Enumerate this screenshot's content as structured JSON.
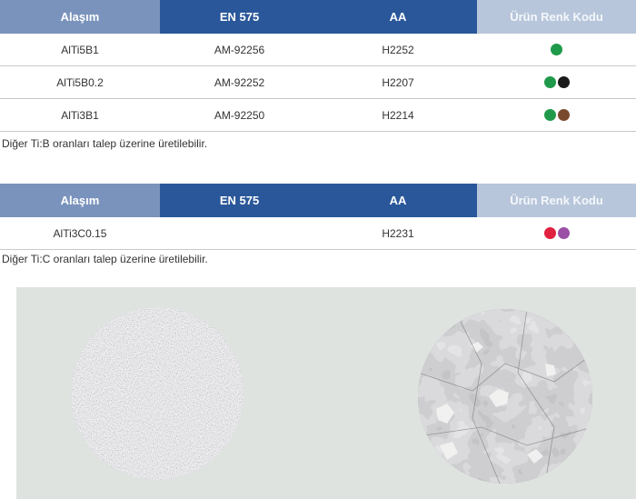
{
  "table1": {
    "headers": [
      "Alaşım",
      "EN 575",
      "AA",
      "Ürün Renk Kodu"
    ],
    "rows": [
      {
        "alloy": "AlTi5B1",
        "en575": "AM-92256",
        "aa": "H2252",
        "colors": [
          "#1f9a4a"
        ]
      },
      {
        "alloy": "AlTi5B0.2",
        "en575": "AM-92252",
        "aa": "H2207",
        "colors": [
          "#1f9a4a",
          "#1a1a1a"
        ]
      },
      {
        "alloy": "AlTi3B1",
        "en575": "AM-92250",
        "aa": "H2214",
        "colors": [
          "#1f9a4a",
          "#7a4a2e"
        ]
      }
    ],
    "note": "Diğer Ti:B oranları talep üzerine üretilebilir."
  },
  "table2": {
    "headers": [
      "Alaşım",
      "EN 575",
      "AA",
      "Ürün Renk Kodu"
    ],
    "rows": [
      {
        "alloy": "AlTi3C0.15",
        "en575": "",
        "aa": "H2231",
        "colors": [
          "#e0213f",
          "#9b4fa6"
        ]
      }
    ],
    "note": "Diğer Ti:C oranları talep üzerine üretilebilir."
  },
  "images": {
    "left": "fine-grain-microstructure",
    "right": "coarse-grain-microstructure"
  }
}
